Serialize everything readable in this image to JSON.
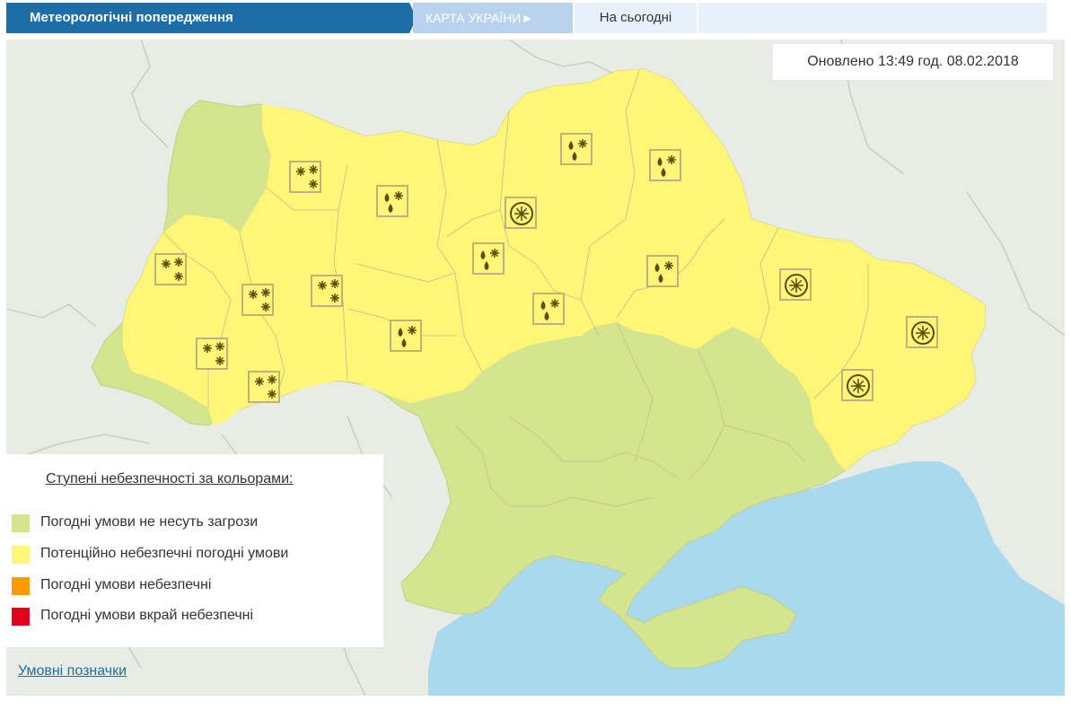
{
  "header": {
    "title": "Метеорологічні попередження",
    "map_tab_label": "КАРТА УКРАЇНИ",
    "map_tab_arrow": "▶",
    "today_tab_label": "На сьогодні"
  },
  "map": {
    "updated_text": "Оновлено 13:49 год. 08.02.2018",
    "colors": {
      "water": "#a9d9ec",
      "land_outside": "#e9ece4",
      "level_no_threat": "#d5e48e",
      "level_potential": "#fff678",
      "level_dangerous": "#ff9900",
      "level_extreme": "#e3001b",
      "region_border": "#c8c88a",
      "icon_ink": "#5a4a10"
    },
    "warning_icons": [
      {
        "name": "snow-icon",
        "glyph": "snow-three"
      },
      {
        "name": "snow-icon",
        "glyph": "snow-three"
      },
      {
        "name": "snow-icon",
        "glyph": "snow-three"
      },
      {
        "name": "snow-icon",
        "glyph": "snow-three"
      },
      {
        "name": "snow-icon",
        "glyph": "snow-three"
      },
      {
        "name": "snow-icon",
        "glyph": "snow-three"
      },
      {
        "name": "sleet-icon",
        "glyph": "drops-snow"
      },
      {
        "name": "sleet-icon",
        "glyph": "drops-snow"
      },
      {
        "name": "sleet-icon",
        "glyph": "drops-snow"
      },
      {
        "name": "sleet-icon",
        "glyph": "drops-snow"
      },
      {
        "name": "sleet-icon",
        "glyph": "drops-snow"
      },
      {
        "name": "sleet-icon",
        "glyph": "drops-snow"
      },
      {
        "name": "sleet-icon",
        "glyph": "drops-snow"
      },
      {
        "name": "ice-icon",
        "glyph": "ice-circle"
      },
      {
        "name": "ice-icon",
        "glyph": "ice-circle"
      },
      {
        "name": "ice-icon",
        "glyph": "ice-circle"
      },
      {
        "name": "ice-icon",
        "glyph": "ice-circle"
      }
    ]
  },
  "legend": {
    "title": "Ступені небезпечності за кольорами:",
    "items": [
      {
        "label": "Погодні умови не несуть загрози",
        "color": "#d5e48e"
      },
      {
        "label": "Потенційно небезпечні погодні умови",
        "color": "#fff678"
      },
      {
        "label": "Погодні умови небезпечні",
        "color": "#ff9900"
      },
      {
        "label": "Погодні умови вкрай небезпечні",
        "color": "#e3001b"
      }
    ],
    "link_label": "Умовні позначки"
  }
}
